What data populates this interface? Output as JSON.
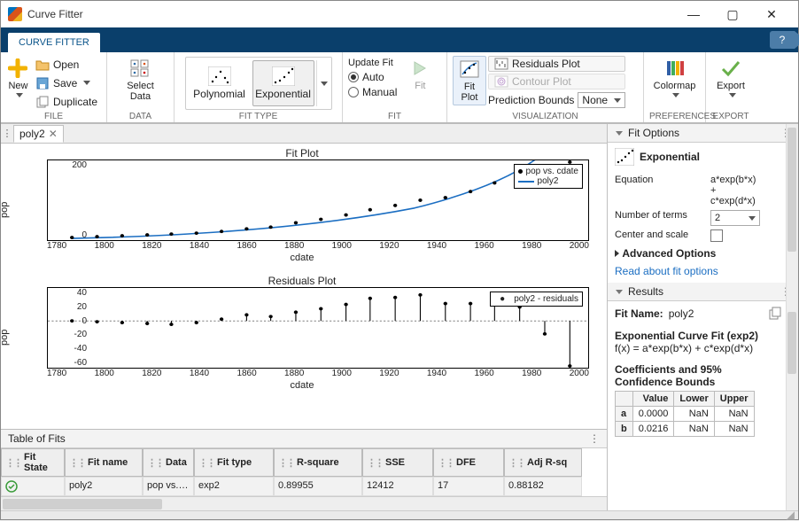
{
  "window": {
    "title": "Curve Fitter"
  },
  "tabs": {
    "main": "CURVE FITTER"
  },
  "ribbon": {
    "file": {
      "label": "FILE",
      "new": "New",
      "open": "Open",
      "save": "Save",
      "duplicate": "Duplicate"
    },
    "data": {
      "label": "DATA",
      "select_data": "Select\nData"
    },
    "fit_type": {
      "label": "FIT TYPE",
      "polynomial": "Polynomial",
      "exponential": "Exponential"
    },
    "fit": {
      "label": "FIT",
      "update": "Update Fit",
      "auto": "Auto",
      "manual": "Manual",
      "fit_btn": "Fit"
    },
    "visualization": {
      "label": "VISUALIZATION",
      "fit_plot": "Fit\nPlot",
      "residuals": "Residuals Plot",
      "contour": "Contour Plot",
      "pred_bounds": "Prediction Bounds",
      "pred_value": "None"
    },
    "preferences": {
      "label": "PREFERENCES",
      "colormap": "Colormap"
    },
    "export": {
      "label": "EXPORT",
      "export": "Export"
    }
  },
  "doc_tab": "poly2",
  "fit_plot": {
    "title": "Fit Plot",
    "xlabel": "cdate",
    "ylabel": "pop",
    "legend": {
      "scatter": "pop vs. cdate",
      "line": "poly2"
    },
    "xticks": [
      "1780",
      "1800",
      "1820",
      "1840",
      "1860",
      "1880",
      "1900",
      "1920",
      "1940",
      "1960",
      "1980",
      "2000"
    ],
    "yticks": [
      "200",
      "0"
    ]
  },
  "residuals_plot": {
    "title": "Residuals Plot",
    "xlabel": "cdate",
    "ylabel": "pop",
    "legend": "poly2 - residuals",
    "xticks": [
      "1780",
      "1800",
      "1820",
      "1840",
      "1860",
      "1880",
      "1900",
      "1920",
      "1940",
      "1960",
      "1980",
      "2000"
    ],
    "yticks": [
      "40",
      "20",
      "0",
      "-20",
      "-40",
      "-60"
    ]
  },
  "chart_data": [
    {
      "type": "scatter+line",
      "title": "Fit Plot",
      "xlabel": "cdate",
      "ylabel": "pop",
      "xlim": [
        1780,
        2000
      ],
      "ylim": [
        -20,
        260
      ],
      "series": [
        {
          "name": "pop vs. cdate",
          "style": "scatter",
          "x": [
            1790,
            1800,
            1810,
            1820,
            1830,
            1840,
            1850,
            1860,
            1870,
            1880,
            1890,
            1900,
            1910,
            1920,
            1930,
            1940,
            1950,
            1960,
            1970,
            1980,
            1990
          ],
          "y": [
            3.9,
            5.3,
            7.2,
            9.6,
            12.9,
            17.1,
            23.2,
            31.4,
            38.6,
            50.2,
            63.0,
            76.2,
            92.2,
            106.0,
            123.2,
            132.2,
            151.3,
            179.3,
            203.3,
            226.5,
            248.7
          ]
        },
        {
          "name": "poly2",
          "style": "line",
          "x": [
            1790,
            1850,
            1900,
            1950,
            1990
          ],
          "y": [
            3,
            20,
            55,
            140,
            300
          ]
        }
      ]
    },
    {
      "type": "stem",
      "title": "Residuals Plot",
      "xlabel": "cdate",
      "ylabel": "pop",
      "xlim": [
        1780,
        2000
      ],
      "ylim": [
        -60,
        45
      ],
      "series": [
        {
          "name": "poly2 - residuals",
          "x": [
            1790,
            1800,
            1810,
            1820,
            1830,
            1840,
            1850,
            1860,
            1870,
            1880,
            1890,
            1900,
            1910,
            1920,
            1930,
            1940,
            1950,
            1960,
            1970,
            1980,
            1990
          ],
          "y": [
            0,
            -1,
            -2,
            -3,
            -4,
            -2,
            2,
            8,
            6,
            12,
            16,
            22,
            30,
            32,
            36,
            24,
            24,
            28,
            18,
            -18,
            -60
          ]
        }
      ]
    }
  ],
  "table": {
    "title": "Table of Fits",
    "headers": [
      "Fit State",
      "Fit name",
      "Data",
      "Fit type",
      "R-square",
      "SSE",
      "DFE",
      "Adj R-sq"
    ],
    "rows": [
      {
        "state": "ok",
        "name": "poly2",
        "data": "pop vs.…",
        "type": "exp2",
        "rsq": "0.89955",
        "sse": "12412",
        "dfe": "17",
        "adjrsq": "0.88182"
      }
    ]
  },
  "right": {
    "fit_options": {
      "title": "Fit Options",
      "model": "Exponential",
      "equation_label": "Equation",
      "equation": "a*exp(b*x)\n+\nc*exp(d*x)",
      "nterms_label": "Number of terms",
      "nterms_value": "2",
      "center_scale": "Center and scale",
      "advanced": "Advanced Options",
      "read_about": "Read about fit options"
    },
    "results": {
      "title": "Results",
      "fit_name_label": "Fit Name:",
      "fit_name": "poly2",
      "fit_eq_title": "Exponential Curve Fit (exp2)",
      "fit_eq": "f(x) = a*exp(b*x) + c*exp(d*x)",
      "coef_title": "Coefficients and 95% Confidence Bounds",
      "coef_headers": [
        "",
        "Value",
        "Lower",
        "Upper"
      ],
      "coef_rows": [
        {
          "name": "a",
          "value": "0.0000",
          "lower": "NaN",
          "upper": "NaN"
        },
        {
          "name": "b",
          "value": "0.0216",
          "lower": "NaN",
          "upper": "NaN"
        }
      ]
    }
  }
}
